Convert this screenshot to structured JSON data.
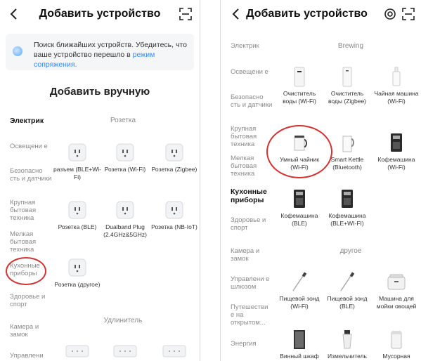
{
  "left": {
    "title": "Добавить устройство",
    "banner_text": "Поиск ближайших устройств. Убедитесь, что ваше устройство перешло в",
    "banner_link": "режим сопряжения.",
    "section_title": "Добавить вручную",
    "sidebar": [
      "Электрик",
      "Освещени е",
      "Безопасно сть и датчики",
      "Крупная бытовая техника",
      "Мелкая бытовая техника",
      "Кухонные приборы",
      "Здоровье и спорт",
      "Камера и замок",
      "Управлени"
    ],
    "cat_socket": "Розетка",
    "cat_extender": "Удлинитель",
    "devices": [
      "разъем (BLE+Wi-Fi)",
      "Розетка (Wi-Fi)",
      "Розетка (Zigbee)",
      "Розетка (BLE)",
      "Dualband Plug (2.4GHz&5GHz)",
      "Розетка (NB-IoT)",
      "Розетка (другое)"
    ]
  },
  "right": {
    "title": "Добавить устройство",
    "sidebar": [
      "Электрик",
      "Освещени е",
      "Безопасно сть и датчики",
      "Крупная бытовая техника",
      "Мелкая бытовая техника",
      "Кухонные приборы",
      "Здоровье и спорт",
      "Камера и замок",
      "Управлени е шлюзом",
      "Путешестви е на открытом...",
      "Энергия"
    ],
    "cat_brewing": "Brewing",
    "cat_other": "другое",
    "devices": [
      "Очиститель воды (Wi-Fi)",
      "Очиститель воды (Zigbee)",
      "Чайная машина (Wi-Fi)",
      "Умный чайник (Wi-Fi)",
      "Smart Kettle (Bluetooth)",
      "Кофемашина (Wi-Fi)",
      "Кофемашина (BLE)",
      "Кофемашина (BLE+WI-FI)",
      "Пищевой зонд (Wi-Fi)",
      "Пищевой зонд (BLE)",
      "Машина для мойки овощей",
      "Винный шкаф",
      "Измельчитель",
      "Мусорная"
    ]
  },
  "colors": {
    "accent": "#2f8cff",
    "highlight": "#d63131"
  }
}
